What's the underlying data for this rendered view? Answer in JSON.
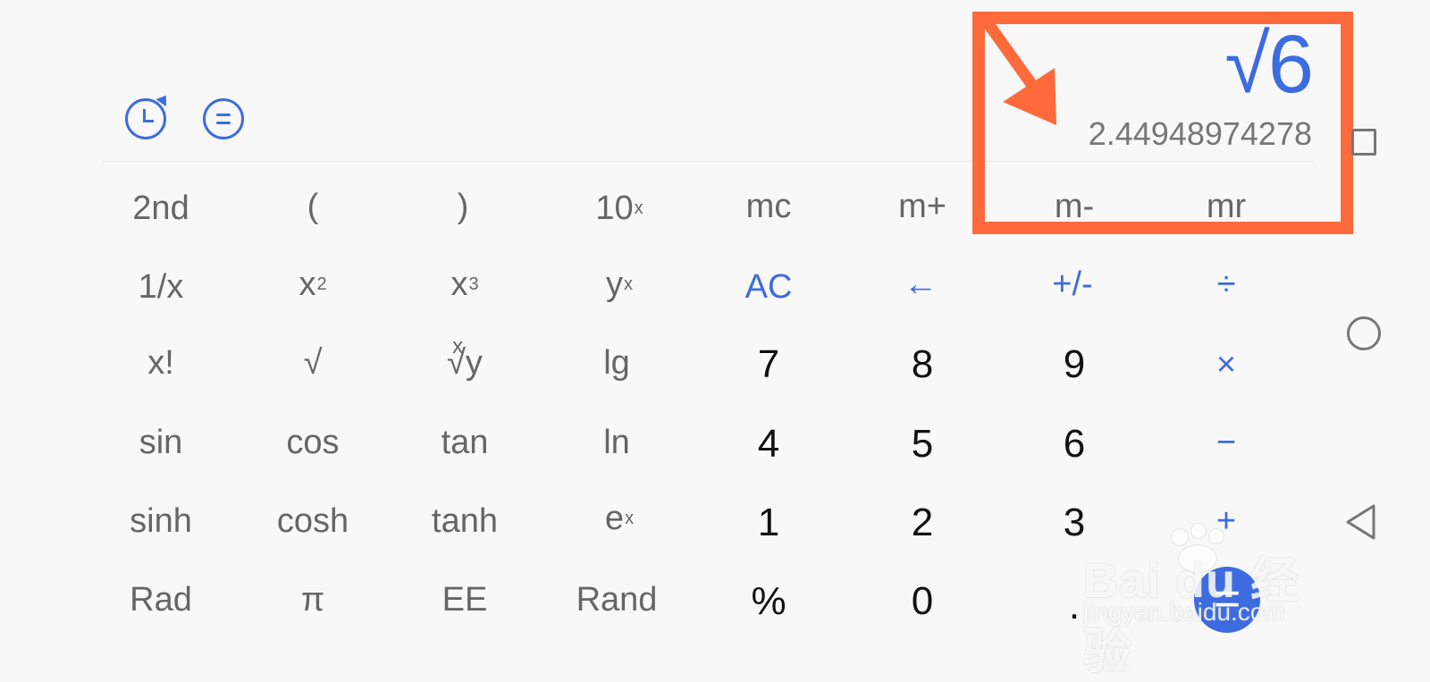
{
  "display": {
    "expression": "√6",
    "result": "2.44948974278"
  },
  "toolbar": {
    "history_icon": "history-icon",
    "menu_icon": "menu-icon"
  },
  "keypad": {
    "row1": [
      "2nd",
      "(",
      ")",
      "10x",
      "mc",
      "m+",
      "m-",
      "mr"
    ],
    "row2": [
      "1/x",
      "x2",
      "x3",
      "yx",
      "AC",
      "←",
      "+/-",
      "÷"
    ],
    "row3": [
      "x!",
      "√",
      "x√y",
      "lg",
      "7",
      "8",
      "9",
      "×"
    ],
    "row4": [
      "sin",
      "cos",
      "tan",
      "ln",
      "4",
      "5",
      "6",
      "−"
    ],
    "row5": [
      "sinh",
      "cosh",
      "tanh",
      "ex",
      "1",
      "2",
      "3",
      "+"
    ],
    "row6": [
      "Rad",
      "π",
      "EE",
      "Rand",
      "%",
      "0",
      ".",
      "="
    ]
  },
  "watermark": {
    "brand": "Bai du 经验",
    "domain": "jingyan.baidu.com"
  },
  "colors": {
    "accent": "#3d6be0",
    "annotation": "#ff6a3d",
    "background": "#f7f8f7",
    "text_secondary": "#666666",
    "digits": "#111111"
  }
}
